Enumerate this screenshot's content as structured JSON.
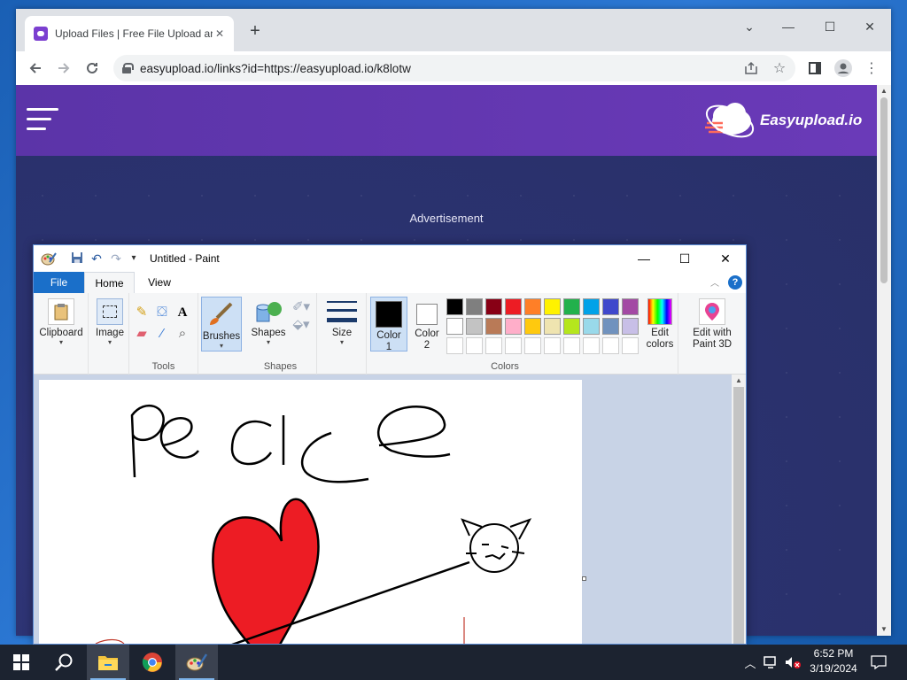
{
  "browser": {
    "tab_title": "Upload Files | Free File Upload an",
    "tab_close": "✕",
    "new_tab": "+",
    "url": "easyupload.io/links?id=https://easyupload.io/k8lotw",
    "window_controls": {
      "minimize": "—",
      "restore": "☐",
      "close": "✕",
      "menu": "⌄"
    }
  },
  "site": {
    "logo_text": "Easyupload.io",
    "advertisement": "Advertisement",
    "colors": {
      "header": "#6a3ab8",
      "background": "#2b3270"
    }
  },
  "paint": {
    "title": "Untitled - Paint",
    "tabs": {
      "file": "File",
      "home": "Home",
      "view": "View"
    },
    "groups": {
      "clipboard": "Clipboard",
      "image": "Image",
      "tools": "Tools",
      "brushes": "Brushes",
      "shapes_btn": "Shapes",
      "shapes_group": "Shapes",
      "size": "Size",
      "color1": "Color 1",
      "color2": "Color 2",
      "colors": "Colors",
      "edit_colors": "Edit colors",
      "edit_3d": "Edit with Paint 3D"
    },
    "palette_row1": [
      "#000000",
      "#7f7f7f",
      "#880015",
      "#ed1c24",
      "#ff7f27",
      "#fff200",
      "#22b14c",
      "#00a2e8",
      "#3f48cc",
      "#a349a4"
    ],
    "palette_row2": [
      "#ffffff",
      "#c3c3c3",
      "#b97a57",
      "#ffaec9",
      "#ffc90e",
      "#efe4b0",
      "#b5e61d",
      "#99d9ea",
      "#7092be",
      "#c8bfe7"
    ],
    "canvas_text": "pedce",
    "heart_color": "#ed1c24"
  },
  "taskbar": {
    "time": "6:52 PM",
    "date": "3/19/2024"
  }
}
